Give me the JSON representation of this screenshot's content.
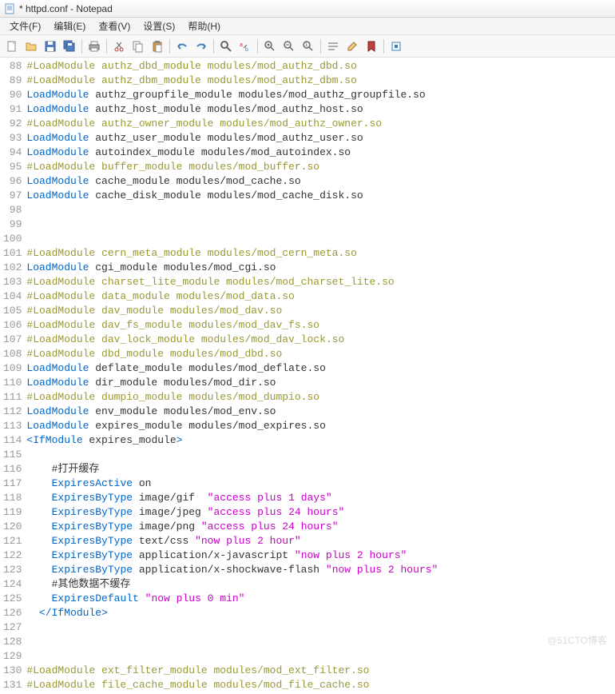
{
  "title": "* httpd.conf - Notepad",
  "menu": {
    "file": "文件(F)",
    "edit": "编辑(E)",
    "view": "查看(V)",
    "settings": "设置(S)",
    "help": "帮助(H)"
  },
  "lines": [
    {
      "num": 88,
      "tokens": [
        {
          "cls": "comment",
          "t": "#LoadModule authz_dbd_module modules/mod_authz_dbd.so"
        }
      ]
    },
    {
      "num": 89,
      "tokens": [
        {
          "cls": "comment",
          "t": "#LoadModule authz_dbm_module modules/mod_authz_dbm.so"
        }
      ]
    },
    {
      "num": 90,
      "tokens": [
        {
          "cls": "keyword",
          "t": "LoadModule"
        },
        {
          "cls": "text",
          "t": " authz_groupfile_module modules/mod_authz_groupfile.so"
        }
      ]
    },
    {
      "num": 91,
      "tokens": [
        {
          "cls": "keyword",
          "t": "LoadModule"
        },
        {
          "cls": "text",
          "t": " authz_host_module modules/mod_authz_host.so"
        }
      ]
    },
    {
      "num": 92,
      "tokens": [
        {
          "cls": "comment",
          "t": "#LoadModule authz_owner_module modules/mod_authz_owner.so"
        }
      ]
    },
    {
      "num": 93,
      "tokens": [
        {
          "cls": "keyword",
          "t": "LoadModule"
        },
        {
          "cls": "text",
          "t": " authz_user_module modules/mod_authz_user.so"
        }
      ]
    },
    {
      "num": 94,
      "tokens": [
        {
          "cls": "keyword",
          "t": "LoadModule"
        },
        {
          "cls": "text",
          "t": " autoindex_module modules/mod_autoindex.so"
        }
      ]
    },
    {
      "num": 95,
      "tokens": [
        {
          "cls": "comment",
          "t": "#LoadModule buffer_module modules/mod_buffer.so"
        }
      ]
    },
    {
      "num": 96,
      "tokens": [
        {
          "cls": "keyword",
          "t": "LoadModule"
        },
        {
          "cls": "text",
          "t": " cache_module modules/mod_cache.so"
        }
      ]
    },
    {
      "num": 97,
      "tokens": [
        {
          "cls": "keyword",
          "t": "LoadModule"
        },
        {
          "cls": "text",
          "t": " cache_disk_module modules/mod_cache_disk.so"
        }
      ]
    },
    {
      "num": 98,
      "tokens": []
    },
    {
      "num": 99,
      "tokens": []
    },
    {
      "num": 100,
      "tokens": []
    },
    {
      "num": 101,
      "tokens": [
        {
          "cls": "comment",
          "t": "#LoadModule cern_meta_module modules/mod_cern_meta.so"
        }
      ]
    },
    {
      "num": 102,
      "tokens": [
        {
          "cls": "keyword",
          "t": "LoadModule"
        },
        {
          "cls": "text",
          "t": " cgi_module modules/mod_cgi.so"
        }
      ]
    },
    {
      "num": 103,
      "tokens": [
        {
          "cls": "comment",
          "t": "#LoadModule charset_lite_module modules/mod_charset_lite.so"
        }
      ]
    },
    {
      "num": 104,
      "tokens": [
        {
          "cls": "comment",
          "t": "#LoadModule data_module modules/mod_data.so"
        }
      ]
    },
    {
      "num": 105,
      "tokens": [
        {
          "cls": "comment",
          "t": "#LoadModule dav_module modules/mod_dav.so"
        }
      ]
    },
    {
      "num": 106,
      "tokens": [
        {
          "cls": "comment",
          "t": "#LoadModule dav_fs_module modules/mod_dav_fs.so"
        }
      ]
    },
    {
      "num": 107,
      "tokens": [
        {
          "cls": "comment",
          "t": "#LoadModule dav_lock_module modules/mod_dav_lock.so"
        }
      ]
    },
    {
      "num": 108,
      "tokens": [
        {
          "cls": "comment",
          "t": "#LoadModule dbd_module modules/mod_dbd.so"
        }
      ]
    },
    {
      "num": 109,
      "tokens": [
        {
          "cls": "keyword",
          "t": "LoadModule"
        },
        {
          "cls": "text",
          "t": " deflate_module modules/mod_deflate.so"
        }
      ]
    },
    {
      "num": 110,
      "tokens": [
        {
          "cls": "keyword",
          "t": "LoadModule"
        },
        {
          "cls": "text",
          "t": " dir_module modules/mod_dir.so"
        }
      ]
    },
    {
      "num": 111,
      "tokens": [
        {
          "cls": "comment",
          "t": "#LoadModule dumpio_module modules/mod_dumpio.so"
        }
      ]
    },
    {
      "num": 112,
      "tokens": [
        {
          "cls": "keyword",
          "t": "LoadModule"
        },
        {
          "cls": "text",
          "t": " env_module modules/mod_env.so"
        }
      ]
    },
    {
      "num": 113,
      "tokens": [
        {
          "cls": "keyword",
          "t": "LoadModule"
        },
        {
          "cls": "text",
          "t": " expires_module modules/mod_expires.so"
        }
      ]
    },
    {
      "num": 114,
      "tokens": [
        {
          "cls": "tag",
          "t": "<IfModule"
        },
        {
          "cls": "text",
          "t": " expires_module"
        },
        {
          "cls": "tag",
          "t": ">"
        }
      ]
    },
    {
      "num": 115,
      "tokens": []
    },
    {
      "num": 116,
      "tokens": [
        {
          "cls": "text",
          "t": "    #打开缓存"
        }
      ]
    },
    {
      "num": 117,
      "tokens": [
        {
          "cls": "text",
          "t": "    "
        },
        {
          "cls": "keyword",
          "t": "ExpiresActive"
        },
        {
          "cls": "text",
          "t": " on"
        }
      ]
    },
    {
      "num": 118,
      "tokens": [
        {
          "cls": "text",
          "t": "    "
        },
        {
          "cls": "keyword",
          "t": "ExpiresByType"
        },
        {
          "cls": "text",
          "t": " image/gif  "
        },
        {
          "cls": "string",
          "t": "\"access plus 1 days\""
        }
      ]
    },
    {
      "num": 119,
      "tokens": [
        {
          "cls": "text",
          "t": "    "
        },
        {
          "cls": "keyword",
          "t": "ExpiresByType"
        },
        {
          "cls": "text",
          "t": " image/jpeg "
        },
        {
          "cls": "string",
          "t": "\"access plus 24 hours\""
        }
      ]
    },
    {
      "num": 120,
      "tokens": [
        {
          "cls": "text",
          "t": "    "
        },
        {
          "cls": "keyword",
          "t": "ExpiresByType"
        },
        {
          "cls": "text",
          "t": " image/png "
        },
        {
          "cls": "string",
          "t": "\"access plus 24 hours\""
        }
      ]
    },
    {
      "num": 121,
      "tokens": [
        {
          "cls": "text",
          "t": "    "
        },
        {
          "cls": "keyword",
          "t": "ExpiresByType"
        },
        {
          "cls": "text",
          "t": " text/css "
        },
        {
          "cls": "string",
          "t": "\"now plus 2 hour\""
        }
      ]
    },
    {
      "num": 122,
      "tokens": [
        {
          "cls": "text",
          "t": "    "
        },
        {
          "cls": "keyword",
          "t": "ExpiresByType"
        },
        {
          "cls": "text",
          "t": " application/x-javascript "
        },
        {
          "cls": "string",
          "t": "\"now plus 2 hours\""
        }
      ]
    },
    {
      "num": 123,
      "tokens": [
        {
          "cls": "text",
          "t": "    "
        },
        {
          "cls": "keyword",
          "t": "ExpiresByType"
        },
        {
          "cls": "text",
          "t": " application/x-shockwave-flash "
        },
        {
          "cls": "string",
          "t": "\"now plus 2 hours\""
        }
      ]
    },
    {
      "num": 124,
      "tokens": [
        {
          "cls": "text",
          "t": "    #其他数据不缓存"
        }
      ]
    },
    {
      "num": 125,
      "tokens": [
        {
          "cls": "text",
          "t": "    "
        },
        {
          "cls": "keyword",
          "t": "ExpiresDefault"
        },
        {
          "cls": "text",
          "t": " "
        },
        {
          "cls": "string",
          "t": "\"now plus 0 min\""
        }
      ]
    },
    {
      "num": 126,
      "tokens": [
        {
          "cls": "text",
          "t": "  "
        },
        {
          "cls": "tag",
          "t": "</IfModule>"
        }
      ]
    },
    {
      "num": 127,
      "tokens": []
    },
    {
      "num": 128,
      "tokens": []
    },
    {
      "num": 129,
      "tokens": []
    },
    {
      "num": 130,
      "tokens": [
        {
          "cls": "comment",
          "t": "#LoadModule ext_filter_module modules/mod_ext_filter.so"
        }
      ]
    },
    {
      "num": 131,
      "tokens": [
        {
          "cls": "comment",
          "t": "#LoadModule file_cache_module modules/mod_file_cache.so"
        }
      ]
    }
  ],
  "watermark": "@51CTO博客"
}
